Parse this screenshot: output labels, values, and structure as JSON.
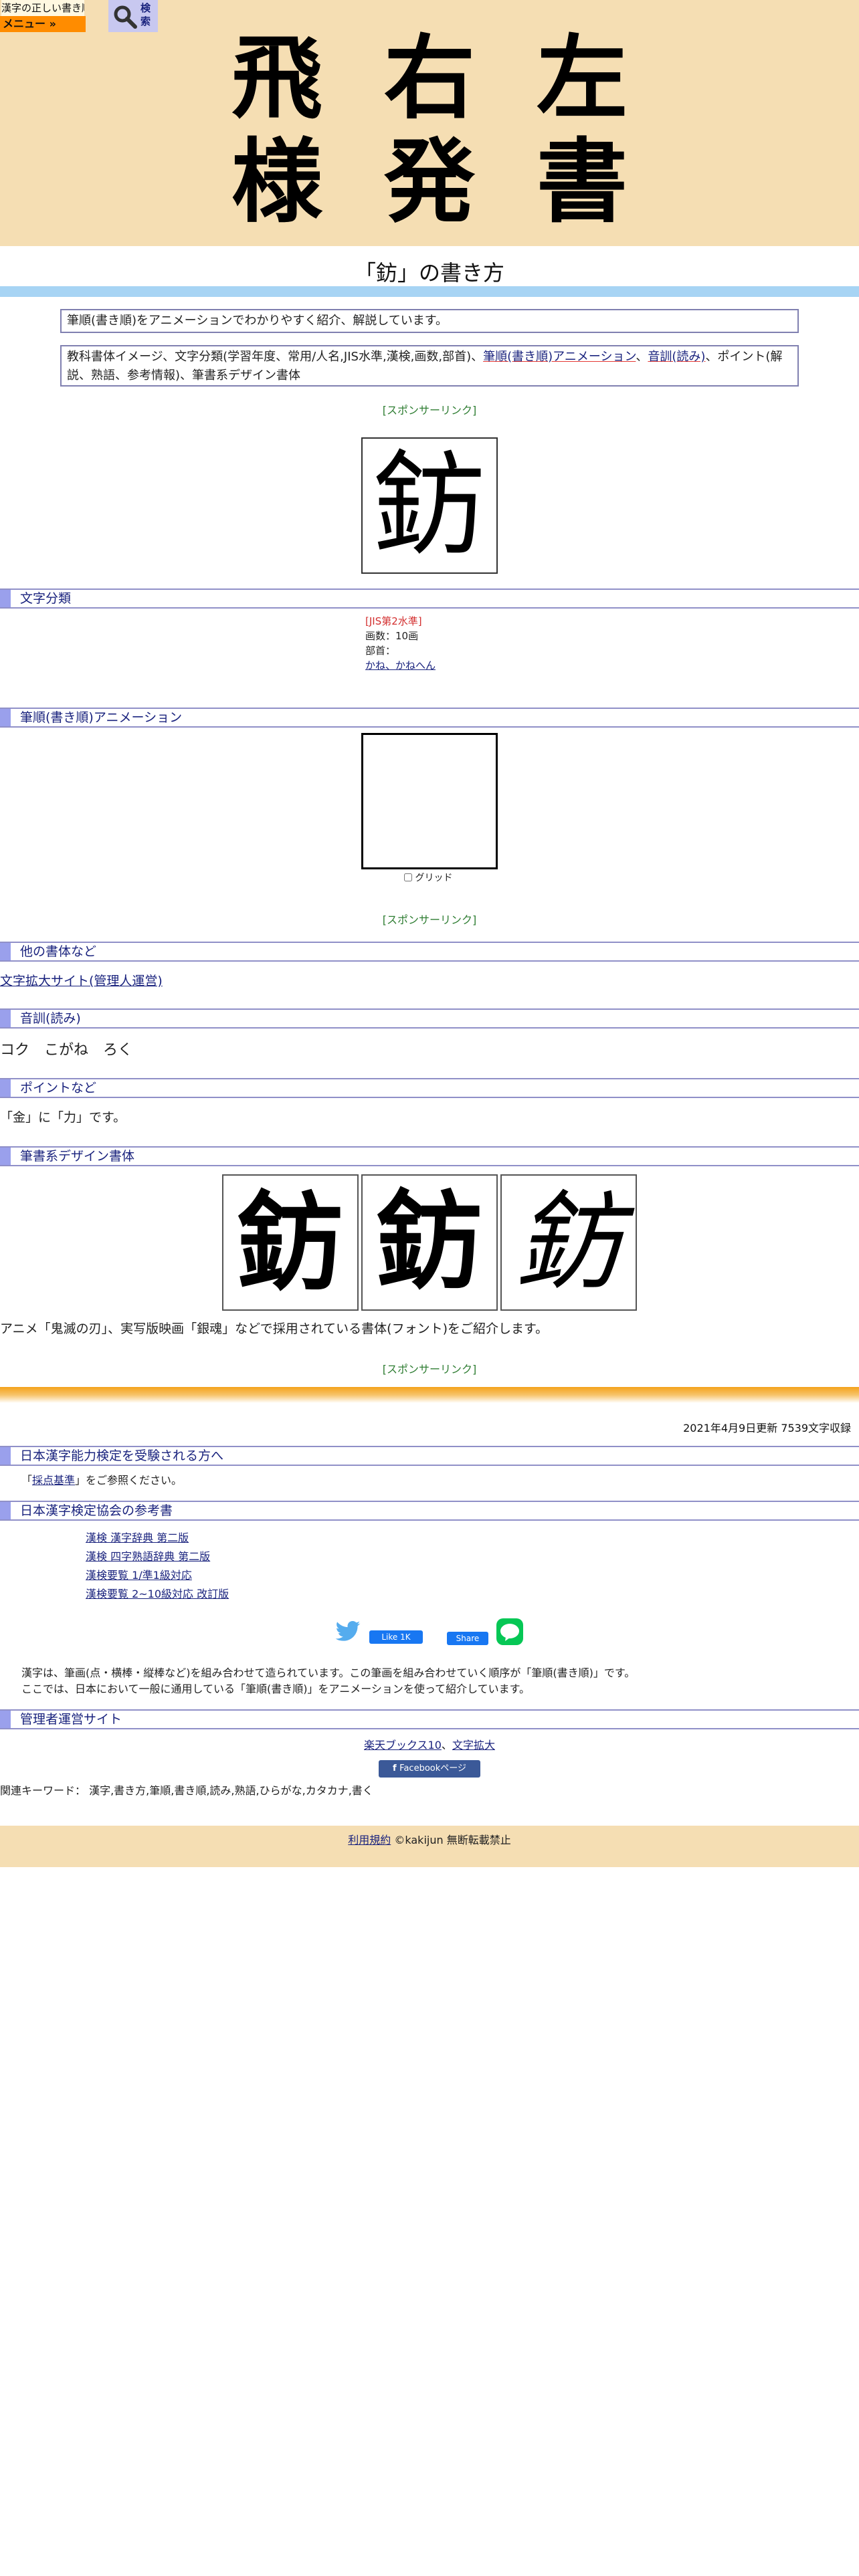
{
  "header": {
    "logo_text": "漢字の正しい書き順(筆順)",
    "menu_label": "メニュー »",
    "search_label": "検索",
    "hero_chars": [
      "飛",
      "右",
      "左",
      "様",
      "発",
      "書"
    ]
  },
  "page": {
    "title": "「鈁」の書き方",
    "intro1": "筆順(書き順)をアニメーションでわかりやすく紹介、解説しています。",
    "intro2_a": "教科書体イメージ、文字分類(学習年度、常用/人名,JIS水準,漢検,画数,部首)、",
    "intro2_link1": "筆順(書き順)アニメーション",
    "intro2_sep": "、",
    "intro2_link2": "音訓(読み)",
    "intro2_b": "、ポイント(解説、熟語、参考情報)、筆書系デザイン書体",
    "sponsor": "[スポンサーリンク]",
    "kanji": "鈁"
  },
  "classification": {
    "heading": "文字分類",
    "jis": "[JIS第2水準]",
    "strokes": "画数：10画",
    "radical_label": "部首：",
    "radical_link": "かね、かねへん"
  },
  "animation": {
    "heading": "筆順(書き順)アニメーション",
    "grid_label": "グリッド"
  },
  "other_fonts": {
    "heading": "他の書体など",
    "link": "文字拡大サイト(管理人運営)"
  },
  "readings": {
    "heading": "音訓(読み)",
    "text": "コク　こがね　ろく"
  },
  "points": {
    "heading": "ポイントなど",
    "text": "「金」に「力」です。"
  },
  "design": {
    "heading": "筆書系デザイン書体",
    "note": "アニメ「鬼滅の刃」、実写版映画「銀魂」などで採用されている書体(フォント)をご紹介します。"
  },
  "meta": {
    "updated": "2021年4月9日更新 7539文字収録"
  },
  "kanken": {
    "heading": "日本漢字能力検定を受験される方へ",
    "ref_prefix": "「",
    "ref_link": "採点基準",
    "ref_suffix": "」をご参照ください。"
  },
  "books": {
    "heading": "日本漢字検定協会の参考書",
    "items": [
      "漢検 漢字辞典 第二版",
      "漢検 四字熟語辞典 第二版",
      "漢検要覧 1/準1級対応",
      "漢検要覧 2~10級対応 改訂版"
    ]
  },
  "social": {
    "fb_like": "Like 1K",
    "fb_share": "Share",
    "line": "LINE"
  },
  "description": {
    "line1": "漢字は、筆画(点・横棒・縦棒など)を組み合わせて造られています。この筆画を組み合わせていく順序が「筆順(書き順)」です。",
    "line2": "ここでは、日本において一般に通用している「筆順(書き順)」をアニメーションを使って紹介しています。"
  },
  "admin": {
    "heading": "管理者運営サイト",
    "link1": "楽天ブックス10",
    "sep": "、",
    "link2": "文字拡大",
    "fb_page": "Facebookページ"
  },
  "keywords": {
    "text": "関連キーワード： 漢字,書き方,筆順,書き順,読み,熟語,ひらがな,カタカナ,書く"
  },
  "footer": {
    "terms": "利用規約",
    "copyright": "©kakijun 無断転載禁止"
  },
  "colors": {
    "header_bg": "#f5deb3",
    "menu_bg": "#ff8c00",
    "section_bar": "#9aa0ec",
    "title_bar": "#a7d4f4",
    "sponsor": "#2e7d32"
  }
}
